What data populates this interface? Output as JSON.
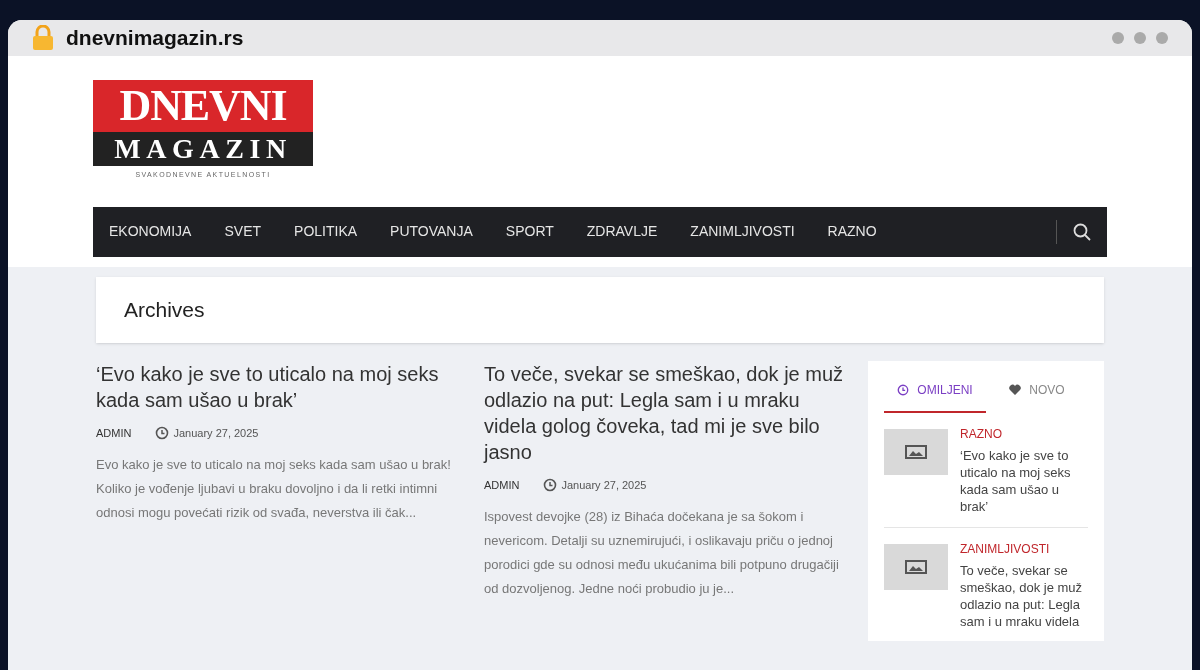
{
  "browser": {
    "url": "dnevnimagazin.rs"
  },
  "logo": {
    "line_1": "DNEVNI",
    "line_2": "MAGAZIN",
    "tagline": "SVAKODNEVNE AKTUELNOSTI"
  },
  "nav": {
    "items": [
      "EKONOMIJA",
      "SVET",
      "POLITIKA",
      "PUTOVANJA",
      "SPORT",
      "ZDRAVLJE",
      "ZANIMLJIVOSTI",
      "RAZNO"
    ]
  },
  "page_title": "Archives",
  "posts": [
    {
      "title": "‘Evo kako je sve to uticalo na moj seks kada sam ušao u brak’",
      "author": "ADMIN",
      "date": "January 27, 2025",
      "excerpt": "Evo kako je sve to uticalo na moj seks kada sam ušao u brak! Koliko je vođenje ljubavi u braku dovoljno i da li retki intimni odnosi mogu povećati rizik od svađa, neverstva ili čak..."
    },
    {
      "title": "To veče, svekar se smeškao, dok je muž odlazio na put: Legla sam i u mraku videla golog čoveka, tad mi je sve bilo jasno",
      "author": "ADMIN",
      "date": "January 27, 2025",
      "excerpt": "Ispovest devojke (28) iz Bihaća dočekana je sa šokom i nevericom. Detalji su uznemirujući, i oslikavaju priču o jednoj porodici gde su odnosi među ukućanima bili potpuno drugačiji od dozvoljenog. Jedne noći probudio ju je..."
    }
  ],
  "sidebar": {
    "tabs": [
      {
        "label": "OMILJENI",
        "selected": true
      },
      {
        "label": "NOVO",
        "selected": false
      }
    ],
    "items": [
      {
        "category": "RAZNO",
        "title": "‘Evo kako je sve to uticalo na moj seks kada sam ušao u brak’"
      },
      {
        "category": "ZANIMLJIVOSTI",
        "title": "To veče, svekar se smeškao, dok je muž odlazio na put: Legla sam i u mraku videla"
      }
    ]
  }
}
